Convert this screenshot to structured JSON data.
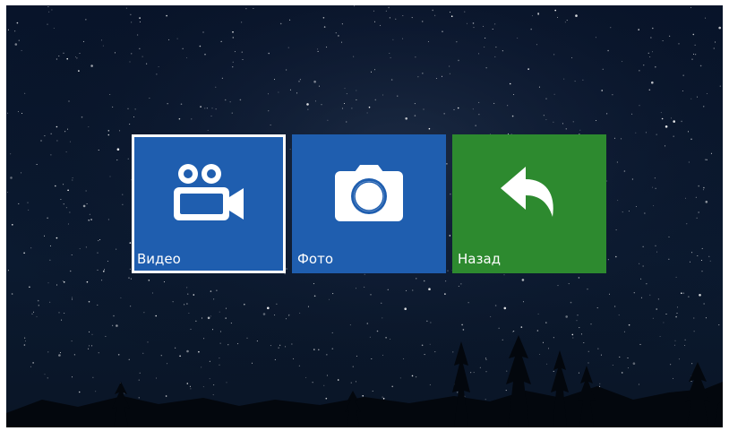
{
  "menu": {
    "items": [
      {
        "label": "Видео",
        "icon": "video-camera-icon",
        "color": "#1f5eaf",
        "selected": true
      },
      {
        "label": "Фото",
        "icon": "camera-icon",
        "color": "#1f5eaf",
        "selected": false
      },
      {
        "label": "Назад",
        "icon": "back-arrow-icon",
        "color": "#2d8a2f",
        "selected": false
      }
    ]
  },
  "colors": {
    "tile_blue": "#1f5eaf",
    "tile_green": "#2d8a2f",
    "selection_border": "#ffffff",
    "background": "#050d1a"
  }
}
